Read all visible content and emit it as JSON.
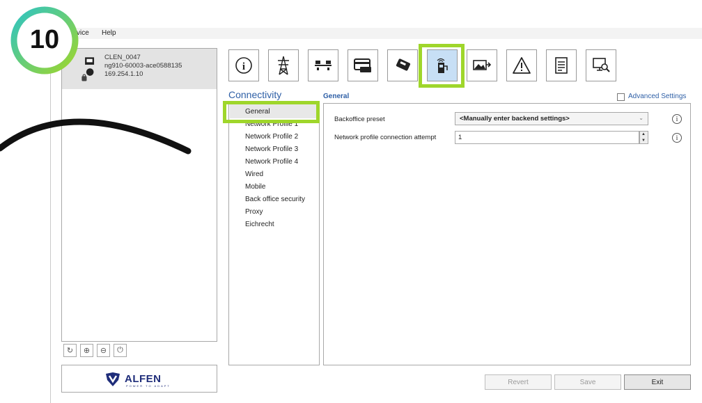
{
  "step": {
    "number": "10"
  },
  "menu": {
    "device": "vice",
    "help": "Help"
  },
  "device": {
    "name": "CLEN_0047",
    "serial": "ng910-60003-ace0588135",
    "ip": "169.254.1.10"
  },
  "left_buttons": [
    {
      "icon": "refresh-icon",
      "glyph": "↻"
    },
    {
      "icon": "add-icon",
      "glyph": "⊕"
    },
    {
      "icon": "remove-icon",
      "glyph": "⊖"
    },
    {
      "icon": "power-icon",
      "glyph": "⏻"
    }
  ],
  "brand": {
    "logo": "ALFEN",
    "tagline": "POWER TO ADAPT"
  },
  "toolbar": {
    "items": [
      "info-icon",
      "grid-tower-icon",
      "balance-icon",
      "card-icon",
      "payment-terminal-icon",
      "charger-connectivity-icon",
      "image-icon",
      "warning-icon",
      "document-icon",
      "monitor-search-icon"
    ],
    "active_index": 5
  },
  "category": {
    "title": "Connectivity",
    "items": [
      "General",
      "Network Profile 1",
      "Network Profile 2",
      "Network Profile 3",
      "Network Profile 4",
      "Wired",
      "Mobile",
      "Back office security",
      "Proxy",
      "Eichrecht"
    ]
  },
  "content": {
    "section_title": "General",
    "advanced_settings_label": "Advanced Settings",
    "fields": {
      "backoffice_preset_label": "Backoffice preset",
      "backoffice_preset_value": "<Manually enter backend settings>",
      "attempt_label": "Network profile connection attempt",
      "attempt_value": "1"
    }
  },
  "buttons": {
    "revert": "Revert",
    "save": "Save",
    "exit": "Exit"
  },
  "colors": {
    "highlight": "#9fd62b",
    "accent": "#2e5fa6",
    "brand": "#1f2d7a",
    "active_tab": "#c7dff5"
  }
}
